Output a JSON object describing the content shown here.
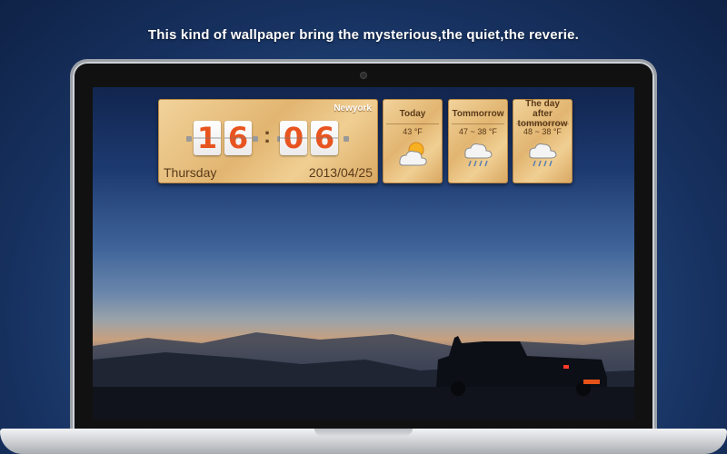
{
  "caption": "This kind of wallpaper bring the mysterious,the quiet,the reverie.",
  "clock": {
    "location": "Newyork",
    "hour_tens": "1",
    "hour_ones": "6",
    "separator": ":",
    "minute_tens": "0",
    "minute_ones": "6",
    "day": "Thursday",
    "date": "2013/04/25"
  },
  "forecast": [
    {
      "title": "Today",
      "temp": "43 °F",
      "icon": "partly-cloudy-icon"
    },
    {
      "title": "Tommorrow",
      "temp": "47 ~ 38 °F",
      "icon": "rain-cloud-icon"
    },
    {
      "title": "The day after tommorrow",
      "temp": "48 ~ 38 °F",
      "icon": "rain-cloud-icon"
    }
  ],
  "colors": {
    "digit": "#e8541f",
    "wood": "#e2b571"
  }
}
